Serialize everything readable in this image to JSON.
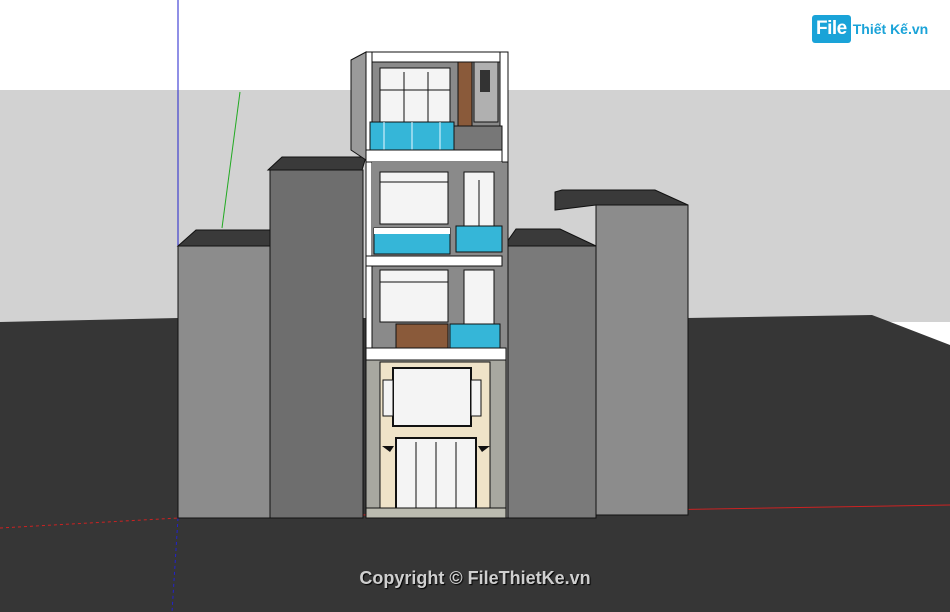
{
  "watermark": {
    "copyright_text": "Copyright © FileThietKe.vn"
  },
  "logo": {
    "mark_text": "File",
    "rest_text": "Thiết Kế.vn"
  },
  "icons": {
    "logo": "file-icon"
  },
  "colors": {
    "sky": "#ffffff",
    "horizon": "#d2d2d2",
    "ground": "#363636",
    "neighbor_light": "#8c8c8c",
    "neighbor_dark": "#666666",
    "facade_frame": "#ffffff",
    "facade_wall": "#8a8a8a",
    "glass_blue": "#35b6d8",
    "wood": "#8a5a3a",
    "ground_floor_wall": "#efe3c8",
    "ground_floor_stone": "#a8a8a0",
    "axis_blue": "#2222cc",
    "axis_green": "#22aa22",
    "axis_red": "#cc2222"
  }
}
